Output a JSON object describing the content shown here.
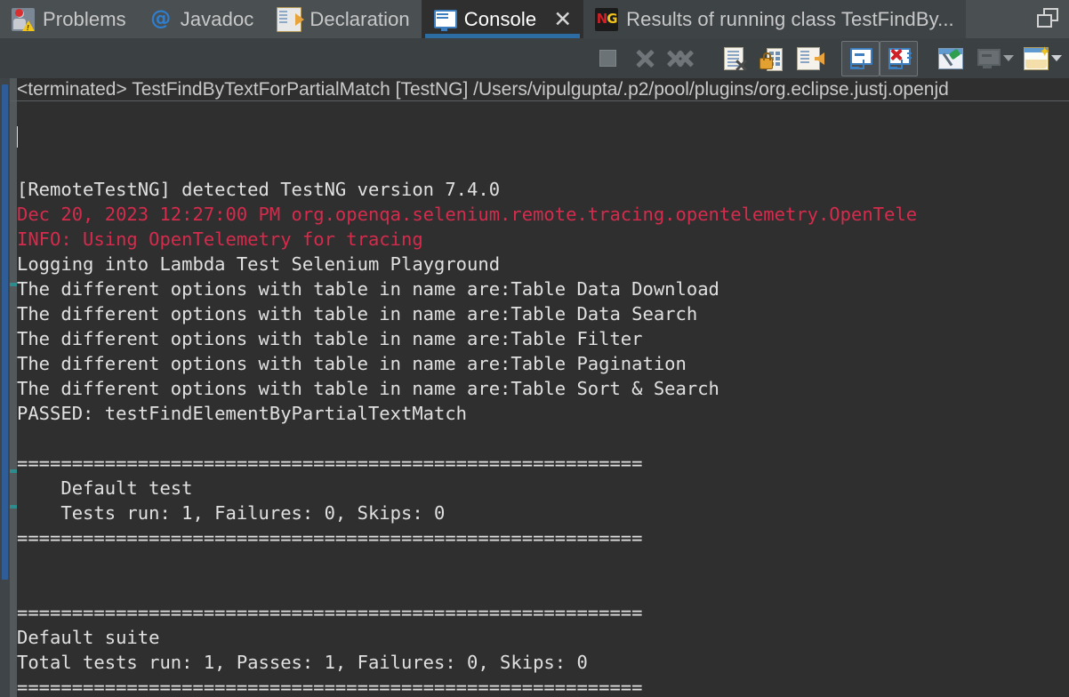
{
  "window": {
    "maximize_icon": "maximize-restore-icon"
  },
  "tabs": [
    {
      "label": "Problems",
      "icon": "problems-icon",
      "active": false
    },
    {
      "label": "Javadoc",
      "icon": "javadoc-at-icon",
      "active": false
    },
    {
      "label": "Declaration",
      "icon": "declaration-icon",
      "active": false
    },
    {
      "label": "Console",
      "icon": "console-monitor-icon",
      "active": true,
      "close_glyph": "✕"
    },
    {
      "label": "Results of running class TestFindBy...",
      "icon": "testng-icon",
      "active": false
    }
  ],
  "testng_icon": {
    "left": "N",
    "right": "G"
  },
  "toolbar": {
    "buttons": [
      {
        "name": "terminate-button",
        "tooltip": "Terminate",
        "enabled": false
      },
      {
        "name": "terminate-all-button",
        "tooltip": "Terminate All",
        "enabled": false
      },
      {
        "name": "remove-all-terminated-button",
        "tooltip": "Remove All Terminated Launches",
        "enabled": false
      },
      {
        "name": "clear-console-button",
        "tooltip": "Clear Console",
        "enabled": true
      },
      {
        "name": "scroll-lock-button",
        "tooltip": "Scroll Lock",
        "enabled": true
      },
      {
        "name": "word-wrap-button",
        "tooltip": "Word Wrap",
        "enabled": true
      },
      {
        "name": "show-console-on-output-button",
        "tooltip": "Show Console When Standard Out Changes",
        "enabled": true,
        "pressed": true
      },
      {
        "name": "show-console-on-error-button",
        "tooltip": "Show Console When Standard Error Changes",
        "enabled": true,
        "pressed": true
      },
      {
        "name": "pin-console-button",
        "tooltip": "Pin Console",
        "enabled": true
      },
      {
        "name": "display-selected-console-button",
        "tooltip": "Display Selected Console",
        "enabled": false,
        "has_caret": true
      },
      {
        "name": "open-console-button",
        "tooltip": "Open Console",
        "enabled": true,
        "has_caret": true
      }
    ]
  },
  "console": {
    "header": "<terminated> TestFindByTextForPartialMatch [TestNG] /Users/vipulgupta/.p2/pool/plugins/org.eclipse.justj.openjd",
    "colors": {
      "background": "#2f2f2f",
      "stdout": "#e0e0e0",
      "stderr": "#d52b4c",
      "tabbar": "#4a4f52",
      "toolbar": "#3b4043",
      "accent_blue": "#2d6ca2",
      "scrollbar_thumb": "#2f5d98"
    },
    "separator": "=========================================================",
    "lines": [
      {
        "text": "[RemoteTestNG] detected TestNG version 7.4.0",
        "stream": "out"
      },
      {
        "text": "Dec 20, 2023 12:27:00 PM org.openqa.selenium.remote.tracing.opentelemetry.OpenTele",
        "stream": "err"
      },
      {
        "text": "INFO: Using OpenTelemetry for tracing",
        "stream": "err"
      },
      {
        "text": "Logging into Lambda Test Selenium Playground",
        "stream": "out"
      },
      {
        "text": "The different options with table in name are:Table Data Download",
        "stream": "out"
      },
      {
        "text": "The different options with table in name are:Table Data Search",
        "stream": "out"
      },
      {
        "text": "The different options with table in name are:Table Filter",
        "stream": "out"
      },
      {
        "text": "The different options with table in name are:Table Pagination",
        "stream": "out"
      },
      {
        "text": "The different options with table in name are:Table Sort & Search",
        "stream": "out"
      },
      {
        "text": "PASSED: testFindElementByPartialTextMatch",
        "stream": "out"
      },
      {
        "text": "",
        "stream": "out"
      },
      {
        "text": "=========================================================",
        "stream": "out"
      },
      {
        "text": "    Default test",
        "stream": "out"
      },
      {
        "text": "    Tests run: 1, Failures: 0, Skips: 0",
        "stream": "out"
      },
      {
        "text": "=========================================================",
        "stream": "out"
      },
      {
        "text": "",
        "stream": "out"
      },
      {
        "text": "",
        "stream": "out"
      },
      {
        "text": "=========================================================",
        "stream": "out"
      },
      {
        "text": "Default suite",
        "stream": "out"
      },
      {
        "text": "Total tests run: 1, Passes: 1, Failures: 0, Skips: 0",
        "stream": "out"
      },
      {
        "text": "=========================================================",
        "stream": "out"
      }
    ]
  }
}
